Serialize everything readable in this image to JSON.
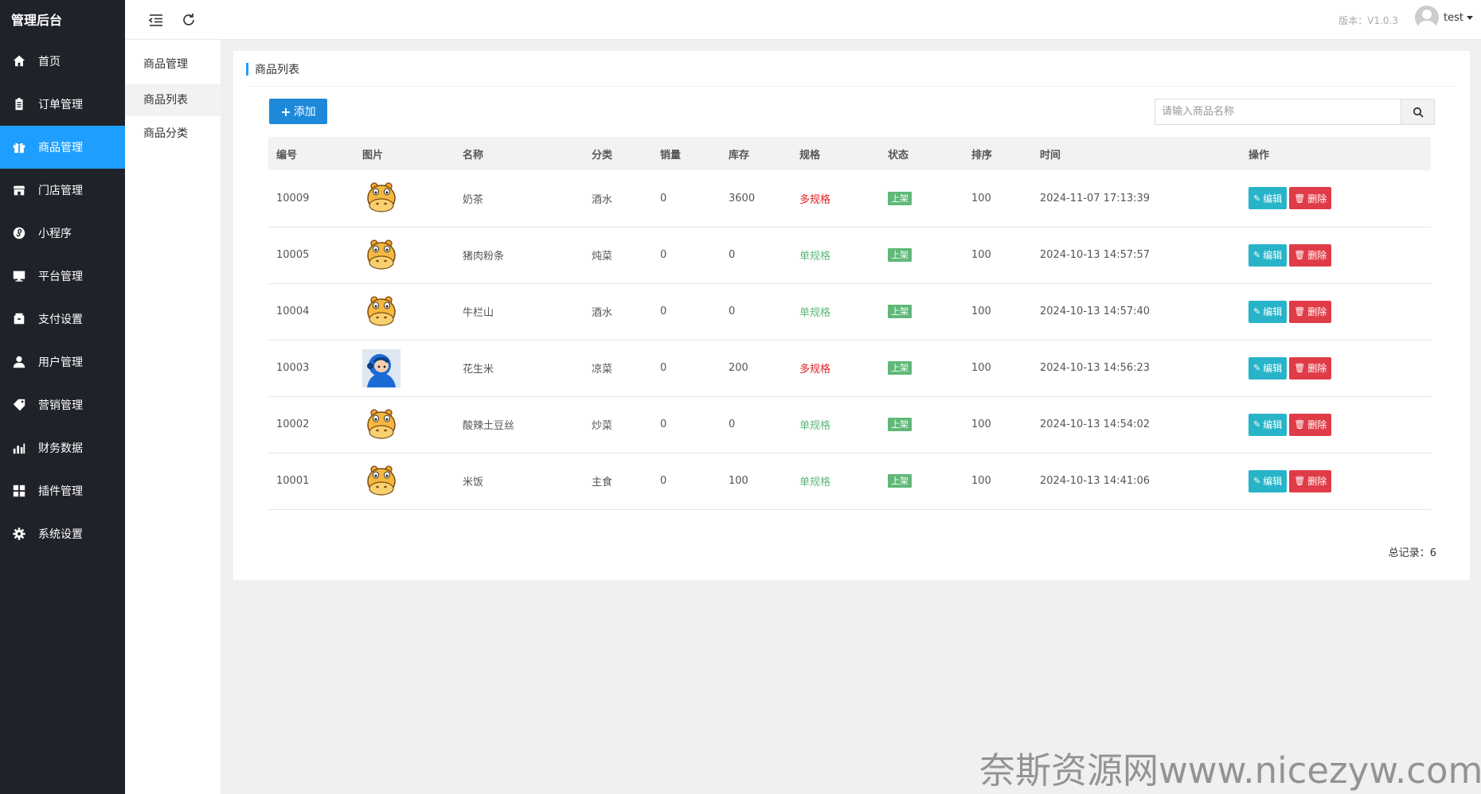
{
  "sidebar": {
    "logo": "管理后台",
    "items": [
      {
        "label": "首页",
        "icon": "home-icon"
      },
      {
        "label": "订单管理",
        "icon": "clipboard-icon"
      },
      {
        "label": "商品管理",
        "icon": "gift-icon",
        "active": true
      },
      {
        "label": "门店管理",
        "icon": "store-icon"
      },
      {
        "label": "小程序",
        "icon": "mini-program-icon"
      },
      {
        "label": "平台管理",
        "icon": "monitor-icon"
      },
      {
        "label": "支付设置",
        "icon": "wallet-icon"
      },
      {
        "label": "用户管理",
        "icon": "user-icon"
      },
      {
        "label": "营销管理",
        "icon": "tag-icon"
      },
      {
        "label": "财务数据",
        "icon": "chart-icon"
      },
      {
        "label": "插件管理",
        "icon": "grid-icon"
      },
      {
        "label": "系统设置",
        "icon": "gear-icon"
      }
    ]
  },
  "subnav": {
    "title": "商品管理",
    "items": [
      {
        "label": "商品列表",
        "active": true
      },
      {
        "label": "商品分类"
      }
    ]
  },
  "topbar": {
    "version": "版本：V1.0.3",
    "username": "test"
  },
  "panel": {
    "title": "商品列表",
    "add_label": "添加",
    "search_placeholder": "请输入商品名称",
    "total": "总记录：6"
  },
  "table": {
    "headers": [
      "编号",
      "图片",
      "名称",
      "分类",
      "销量",
      "库存",
      "规格",
      "状态",
      "排序",
      "时间",
      "操作"
    ],
    "rows": [
      {
        "id": "10009",
        "image": "hippo-avatar",
        "name": "奶茶",
        "category": "酒水",
        "sales": "0",
        "stock": "3600",
        "spec": "多规格",
        "spec_type": "multi",
        "status": "上架",
        "sort": "100",
        "time": "2024-11-07 17:13:39"
      },
      {
        "id": "10005",
        "image": "hippo-avatar",
        "name": "猪肉粉条",
        "category": "炖菜",
        "sales": "0",
        "stock": "0",
        "spec": "单规格",
        "spec_type": "single",
        "status": "上架",
        "sort": "100",
        "time": "2024-10-13 14:57:57"
      },
      {
        "id": "10004",
        "image": "hippo-avatar",
        "name": "牛栏山",
        "category": "酒水",
        "sales": "0",
        "stock": "0",
        "spec": "单规格",
        "spec_type": "single",
        "status": "上架",
        "sort": "100",
        "time": "2024-10-13 14:57:40"
      },
      {
        "id": "10003",
        "image": "helmet-avatar",
        "name": "花生米",
        "category": "凉菜",
        "sales": "0",
        "stock": "200",
        "spec": "多规格",
        "spec_type": "multi",
        "status": "上架",
        "sort": "100",
        "time": "2024-10-13 14:56:23"
      },
      {
        "id": "10002",
        "image": "hippo-avatar",
        "name": "酸辣土豆丝",
        "category": "炒菜",
        "sales": "0",
        "stock": "0",
        "spec": "单规格",
        "spec_type": "single",
        "status": "上架",
        "sort": "100",
        "time": "2024-10-13 14:54:02"
      },
      {
        "id": "10001",
        "image": "hippo-avatar",
        "name": "米饭",
        "category": "主食",
        "sales": "0",
        "stock": "100",
        "spec": "单规格",
        "spec_type": "single",
        "status": "上架",
        "sort": "100",
        "time": "2024-10-13 14:41:06"
      }
    ],
    "edit_label": "编辑",
    "delete_label": "删除"
  },
  "watermark": "奈斯资源网www.nicezyw.com",
  "colors": {
    "sidebar_bg": "#20222a",
    "accent": "#1e9fff",
    "add_button": "#1e88d9",
    "edit": "#28b4c8",
    "delete": "#e03c48",
    "status_green": "#5fb878",
    "spec_multi": "#e02020"
  }
}
